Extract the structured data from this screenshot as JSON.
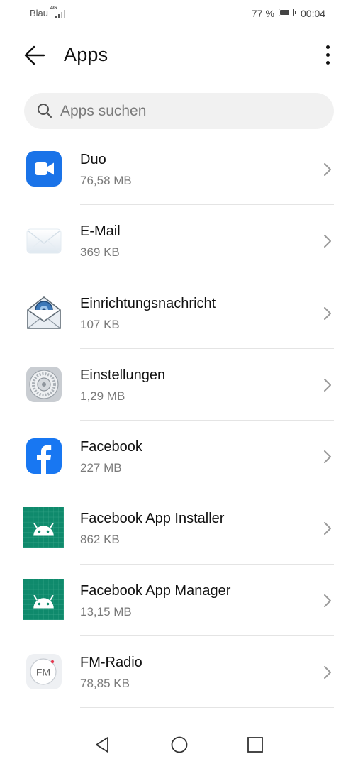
{
  "status_bar": {
    "carrier": "Blau",
    "network": "4G",
    "battery_percent": "77 %",
    "battery_level": 0.77,
    "time": "00:04"
  },
  "header": {
    "title": "Apps",
    "back_icon": "arrow-left-icon",
    "menu_icon": "more-vertical-icon"
  },
  "search": {
    "placeholder": "Apps suchen",
    "icon": "search-icon"
  },
  "apps": [
    {
      "name": "Duo",
      "size": "76,58 MB",
      "icon": "duo-video-icon"
    },
    {
      "name": "E-Mail",
      "size": "369 KB",
      "icon": "email-envelope-icon"
    },
    {
      "name": "Einrichtungsnachricht",
      "size": "107 KB",
      "icon": "setup-message-icon"
    },
    {
      "name": "Einstellungen",
      "size": "1,29 MB",
      "icon": "settings-gear-icon"
    },
    {
      "name": "Facebook",
      "size": "227 MB",
      "icon": "facebook-icon"
    },
    {
      "name": "Facebook App Installer",
      "size": "862 KB",
      "icon": "android-icon"
    },
    {
      "name": "Facebook App Manager",
      "size": "13,15 MB",
      "icon": "android-icon"
    },
    {
      "name": "FM-Radio",
      "size": "78,85 KB",
      "icon": "fm-radio-icon",
      "icon_label": "FM"
    }
  ],
  "nav_bar": {
    "back": "nav-back-icon",
    "home": "nav-home-icon",
    "recents": "nav-recents-icon"
  },
  "colors": {
    "duo": "#1a73e8",
    "facebook": "#1877f2",
    "android_bg": "#0f8a6c",
    "search_bg": "#f1f1f1",
    "divider": "#e4e4e4",
    "secondary_text": "#7a7a7a"
  }
}
